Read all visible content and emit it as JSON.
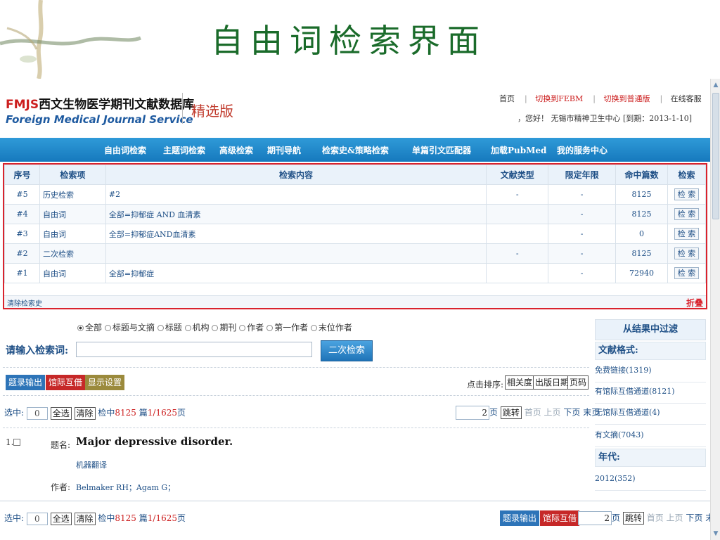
{
  "slide": {
    "title": "自由词检索界面"
  },
  "header": {
    "logo_fmjs": "FMJS",
    "logo_cn": "西文生物医学期刊文献数据库",
    "logo_en": "Foreign Medical Journal Service",
    "edition": "精选版",
    "links": [
      "首页",
      "切换到FEBM",
      "切换到普通版",
      "在线客服"
    ],
    "user_line": "，您好！ 无锡市精神卫生中心 [到期：2013-1-10]"
  },
  "nav": [
    "自由词检索",
    "主题词检索",
    "高级检索",
    "期刊导航",
    "检索史&策略检索",
    "单篇引文匹配器",
    "加载PubMed",
    "我的服务中心"
  ],
  "history": {
    "columns": [
      "序号",
      "检索项",
      "检索内容",
      "文献类型",
      "限定年限",
      "命中篇数",
      "检索"
    ],
    "rows": [
      {
        "no": "#5",
        "field": "历史检索",
        "content": "#2",
        "type": "-",
        "year": "-",
        "hits": "8125",
        "btn": "检 索"
      },
      {
        "no": "#4",
        "field": "自由词",
        "content": "全部=抑郁症 AND 血清素",
        "type": "",
        "year": "-",
        "hits": "8125",
        "btn": "检 索"
      },
      {
        "no": "#3",
        "field": "自由词",
        "content": "全部=抑郁症AND血清素",
        "type": "",
        "year": "-",
        "hits": "0",
        "btn": "检 索"
      },
      {
        "no": "#2",
        "field": "二次检索",
        "content": "",
        "type": "-",
        "year": "-",
        "hits": "8125",
        "btn": "检 索"
      },
      {
        "no": "#1",
        "field": "自由词",
        "content": "全部=抑郁症",
        "type": "",
        "year": "-",
        "hits": "72940",
        "btn": "检 索"
      }
    ],
    "clear_label": "清除检索史",
    "fold_label": "折叠"
  },
  "search": {
    "scopes": [
      "全部",
      "标题与文摘",
      "标题",
      "机构",
      "期刊",
      "作者",
      "第一作者",
      "末位作者"
    ],
    "selected_scope": "全部",
    "prompt": "请输入检索词:",
    "query": "",
    "second_button": "二次检索"
  },
  "actions": {
    "export": "题录输出",
    "ill": "馆际互借",
    "display": "显示设置",
    "sort_label": "点击排序:",
    "sort_options": [
      "相关度",
      "出版日期",
      "页码"
    ]
  },
  "selection": {
    "label": "选中:",
    "count": "0",
    "select_all": "全选",
    "clear": "清除",
    "found_prefix": "检中",
    "found_count": "8125",
    "found_mid": "篇",
    "page_info": "1/1625",
    "page_suffix": "页"
  },
  "pager": {
    "current": "2",
    "page_suffix": "页",
    "jump": "跳转",
    "first": "首页",
    "prev": "上页",
    "next": "下页",
    "last": "末页"
  },
  "record": {
    "index": "1.",
    "title_label": "题名:",
    "title": "Major depressive disorder.",
    "translate": "机器翻译",
    "author_label": "作者:",
    "authors": "Belmaker RH；Agam G；"
  },
  "filter": {
    "head": "从结果中过滤",
    "format_label": "文献格式:",
    "formats": [
      "免费链接(1319)",
      "有馆际互借通道(8121)",
      "无馆际互借通道(4)",
      "有文摘(7043)"
    ],
    "year_label": "年代:",
    "years": [
      "2012(352)"
    ]
  }
}
